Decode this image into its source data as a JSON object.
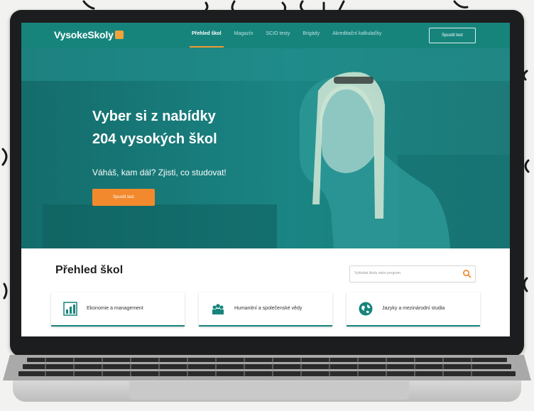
{
  "nav": {
    "logo_text": "VysokeSkoly",
    "items": [
      {
        "label": "Přehled škol",
        "active": true
      },
      {
        "label": "Magazín",
        "active": false
      },
      {
        "label": "SCIO testy",
        "active": false
      },
      {
        "label": "Brigády",
        "active": false
      },
      {
        "label": "Akreditační kalkulačky",
        "active": false
      }
    ],
    "cta_label": "Spustit test"
  },
  "hero": {
    "title_line1": "Vyber si z nabídky",
    "title_line2": "204 vysokých škol",
    "subtitle": "Váháš, kam dál? Zjisti, co studovat!",
    "button_label": "Spustit test"
  },
  "overview": {
    "title": "Přehled škol",
    "search_placeholder": "Vyhledat školu nebo program",
    "categories": [
      {
        "label": "Ekonomie a management",
        "icon": "chart-icon"
      },
      {
        "label": "Humanitní a společenské vědy",
        "icon": "people-icon"
      },
      {
        "label": "Jazyky a mezinárodní studia",
        "icon": "globe-icon"
      }
    ]
  },
  "colors": {
    "brand_teal": "#17847c",
    "accent_orange": "#f2892c"
  }
}
